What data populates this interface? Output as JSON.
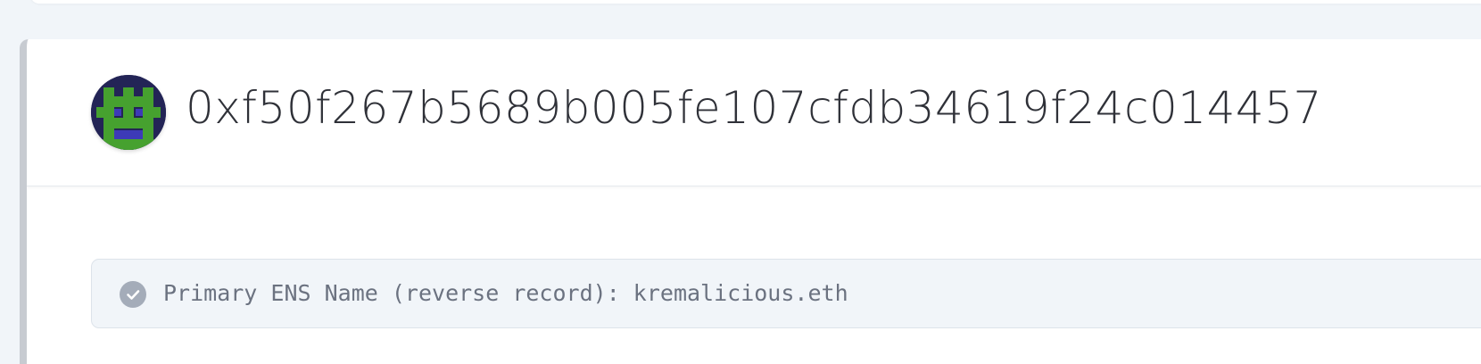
{
  "account": {
    "address": "0xf50f267b5689b005fe107cfdb34619f24c014457",
    "avatar_icon": "pixel-identicon-icon",
    "avatar_colors": {
      "background": "#232456",
      "primary": "#46a12f",
      "accent": "#3d3ab8"
    }
  },
  "ens_notice": {
    "icon": "check-circle-icon",
    "text": "Primary ENS Name (reverse record): kremalicious.eth"
  },
  "colors": {
    "page_background": "#f1f5f9",
    "card_background": "#ffffff",
    "card_accent_border": "#c7cbd1",
    "notice_background": "#f1f5f9",
    "notice_text": "#6b7280",
    "check_icon": "#a4acb9"
  }
}
